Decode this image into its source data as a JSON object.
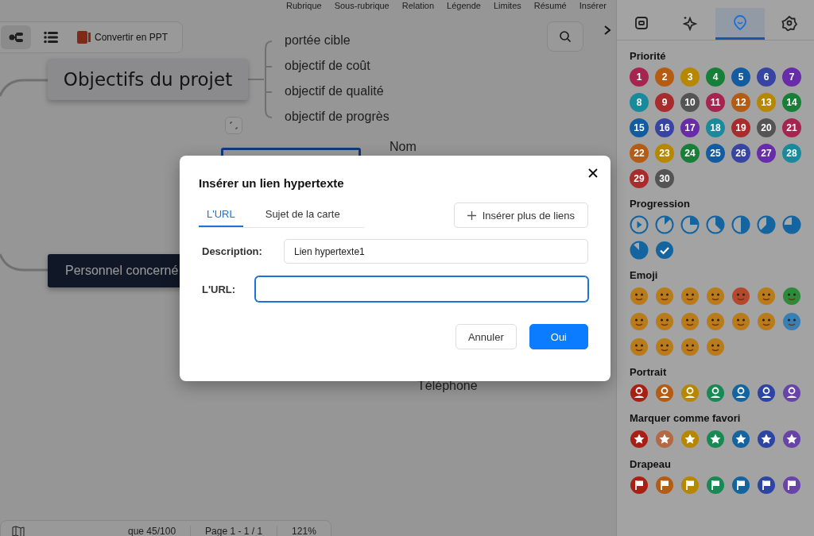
{
  "top_menu": [
    "Rubrique",
    "Sous-rubrique",
    "Relation",
    "Légende",
    "Limites",
    "Résumé",
    "Insérer"
  ],
  "toolbar": {
    "views": [
      {
        "kind": "map",
        "selected": true
      },
      {
        "kind": "outline",
        "selected": false
      }
    ],
    "ppt_button": "Convertir en PPT"
  },
  "canvas": {
    "main_topic": "Objectifs du projet",
    "subtopics": [
      "portée cible",
      "objectif de coût",
      "objectif de qualité",
      "objectif de progrès"
    ],
    "second_topic": "Personnel concerné",
    "branch_labels": [
      "Nom",
      "Téléphone"
    ]
  },
  "status_bar": {
    "topics": "que 45/100",
    "page": "Page 1 - 1 / 1",
    "zoom": "121%"
  },
  "panel": {
    "tabs": [
      {
        "kind": "frame",
        "selected": false
      },
      {
        "kind": "sparkle",
        "selected": false
      },
      {
        "kind": "marker",
        "selected": true
      },
      {
        "kind": "badge",
        "selected": false
      }
    ],
    "priority": {
      "title": "Priorité",
      "items": [
        {
          "label": "1",
          "color": "#a82450"
        },
        {
          "label": "2",
          "color": "#b45c14"
        },
        {
          "label": "3",
          "color": "#b78700"
        },
        {
          "label": "4",
          "color": "#178038"
        },
        {
          "label": "5",
          "color": "#145ca0"
        },
        {
          "label": "6",
          "color": "#3744a2"
        },
        {
          "label": "7",
          "color": "#682ca8"
        },
        {
          "label": "8",
          "color": "#188a9c"
        },
        {
          "label": "9",
          "color": "#a82c2c"
        },
        {
          "label": "10",
          "color": "#545454"
        },
        {
          "label": "11",
          "color": "#a82450"
        },
        {
          "label": "12",
          "color": "#b45c14"
        },
        {
          "label": "13",
          "color": "#b78700"
        },
        {
          "label": "14",
          "color": "#178038"
        },
        {
          "label": "15",
          "color": "#145ca0"
        },
        {
          "label": "16",
          "color": "#3744a2"
        },
        {
          "label": "17",
          "color": "#682ca8"
        },
        {
          "label": "18",
          "color": "#188a9c"
        },
        {
          "label": "19",
          "color": "#a82c2c"
        },
        {
          "label": "20",
          "color": "#545454"
        },
        {
          "label": "21",
          "color": "#a82450"
        },
        {
          "label": "22",
          "color": "#b45c14"
        },
        {
          "label": "23",
          "color": "#b78700"
        },
        {
          "label": "24",
          "color": "#178038"
        },
        {
          "label": "25",
          "color": "#145ca0"
        },
        {
          "label": "26",
          "color": "#3744a2"
        },
        {
          "label": "27",
          "color": "#682ca8"
        },
        {
          "label": "28",
          "color": "#188a9c"
        },
        {
          "label": "29",
          "color": "#a82c2c"
        },
        {
          "label": "30",
          "color": "#545454"
        }
      ]
    },
    "progress": {
      "title": "Progression",
      "items": [
        {
          "kind": "start"
        },
        {
          "kind": "eighth"
        },
        {
          "kind": "quarter"
        },
        {
          "kind": "threeeighths"
        },
        {
          "kind": "half"
        },
        {
          "kind": "fiveeighths"
        },
        {
          "kind": "threequarters"
        },
        {
          "kind": "seveneighths"
        },
        {
          "kind": "done"
        }
      ]
    },
    "emoji": {
      "title": "Emoji",
      "items": [
        {
          "color": "#b87c1a"
        },
        {
          "color": "#b87c1a"
        },
        {
          "color": "#b87c1a"
        },
        {
          "color": "#b87c1a"
        },
        {
          "color": "#b4482c"
        },
        {
          "color": "#b87c1a"
        },
        {
          "color": "#2d8a38"
        },
        {
          "color": "#b87c1a"
        },
        {
          "color": "#b87c1a"
        },
        {
          "color": "#b87c1a"
        },
        {
          "color": "#b87c1a"
        },
        {
          "color": "#b87c1a"
        },
        {
          "color": "#b87c1a"
        },
        {
          "color": "#3880b4"
        },
        {
          "color": "#b87c1a"
        },
        {
          "color": "#b87c1a"
        },
        {
          "color": "#b87c1a"
        },
        {
          "color": "#b87c1a"
        }
      ]
    },
    "portrait": {
      "title": "Portrait",
      "items": [
        {
          "color": "#a82014"
        },
        {
          "color": "#b45c14"
        },
        {
          "color": "#b78700"
        },
        {
          "color": "#178a54"
        },
        {
          "color": "#1464a0"
        },
        {
          "color": "#2c44a2"
        },
        {
          "color": "#6844a8"
        }
      ]
    },
    "favorite": {
      "title": "Marquer comme favori",
      "items": [
        {
          "color": "#a82014"
        },
        {
          "color": "#b46844"
        },
        {
          "color": "#b78700"
        },
        {
          "color": "#178a54"
        },
        {
          "color": "#1464a0"
        },
        {
          "color": "#2c44a2"
        },
        {
          "color": "#6844a8"
        }
      ]
    },
    "flag": {
      "title": "Drapeau",
      "items": [
        {
          "color": "#a82014"
        },
        {
          "color": "#b45c14"
        },
        {
          "color": "#b78700"
        },
        {
          "color": "#178a54"
        },
        {
          "color": "#1464a0"
        },
        {
          "color": "#2c44a2"
        },
        {
          "color": "#6844a8"
        }
      ]
    }
  },
  "dialog": {
    "title": "Insérer un lien hypertexte",
    "tabs": [
      {
        "label": "L'URL",
        "selected": true
      },
      {
        "label": "Sujet de la carte",
        "selected": false
      }
    ],
    "more_links": "Insérer plus de liens",
    "fields": [
      {
        "label": "Description:",
        "value": "Lien hypertexte1",
        "focused": false
      },
      {
        "label": "L'URL:",
        "focused": true
      }
    ],
    "buttons": [
      {
        "label": "Annuler",
        "kind": "secondary"
      },
      {
        "label": "Oui",
        "kind": "primary"
      }
    ]
  }
}
